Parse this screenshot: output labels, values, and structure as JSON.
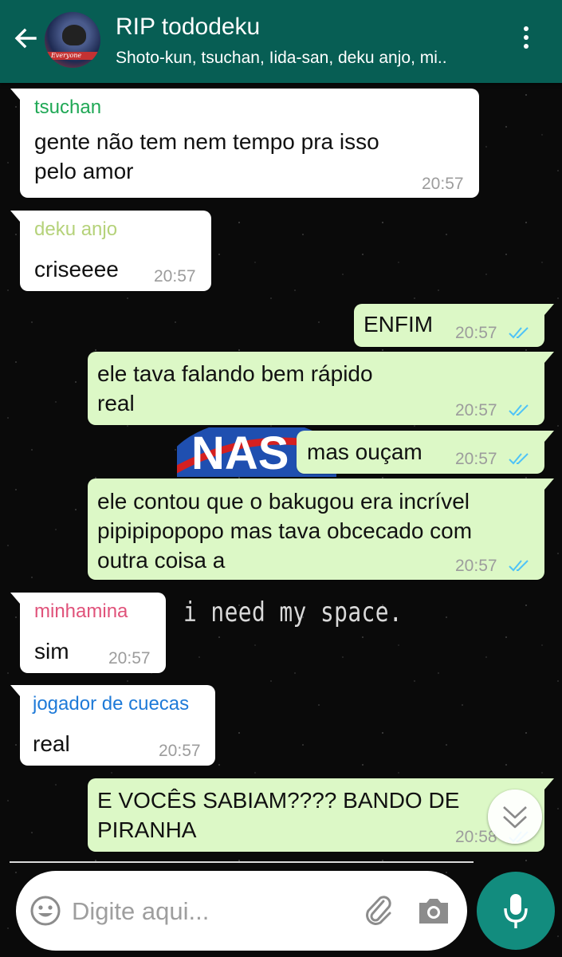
{
  "header": {
    "title": "RIP tododeku",
    "subtitle": "Shoto-kun, tsuchan, Iida-san, deku anjo, mi..",
    "avatar_text": "Everyone"
  },
  "wallpaper": {
    "logo_text": "NAS",
    "caption": "i need my space."
  },
  "messages": [
    {
      "direction": "in",
      "sender": "tsuchan",
      "sender_color": "#1fa855",
      "lines": [
        "gente não tem nem tempo pra isso",
        "pelo amor"
      ],
      "time": "20:57"
    },
    {
      "direction": "in",
      "sender": "deku anjo",
      "sender_color": "#b5d27a",
      "lines": [
        "criseeee"
      ],
      "time": "20:57"
    },
    {
      "direction": "out",
      "lines": [
        "ENFIM"
      ],
      "time": "20:57",
      "status": "read"
    },
    {
      "direction": "out",
      "lines": [
        "ele tava falando bem rápido",
        "real"
      ],
      "time": "20:57",
      "status": "read"
    },
    {
      "direction": "out",
      "lines": [
        "mas ouçam"
      ],
      "time": "20:57",
      "status": "read"
    },
    {
      "direction": "out",
      "lines": [
        "ele contou que o bakugou era incrível",
        "pipipipopopo mas tava obcecado com",
        "outra coisa a"
      ],
      "time": "20:57",
      "status": "read"
    },
    {
      "direction": "in",
      "sender": "minhamina",
      "sender_color": "#e0527a",
      "lines": [
        "sim"
      ],
      "time": "20:57"
    },
    {
      "direction": "in",
      "sender": "jogador de cuecas",
      "sender_color": "#1e7ad8",
      "lines": [
        "real"
      ],
      "time": "20:57"
    },
    {
      "direction": "out",
      "lines": [
        "E VOCÊS SABIAM???? BANDO DE",
        "PIRANHA"
      ],
      "time": "20:58",
      "status": "read"
    }
  ],
  "composer": {
    "placeholder": "Digite aqui..."
  },
  "colors": {
    "header": "#075e54",
    "outgoing_bubble": "#dcf8c6",
    "incoming_bubble": "#ffffff",
    "read_ticks": "#4fc3f7",
    "mic_button": "#128c7e"
  },
  "icons": [
    "back-arrow-icon",
    "overflow-menu-icon",
    "double-check-icon",
    "scroll-down-icon",
    "emoji-icon",
    "paperclip-icon",
    "camera-icon",
    "microphone-icon"
  ]
}
